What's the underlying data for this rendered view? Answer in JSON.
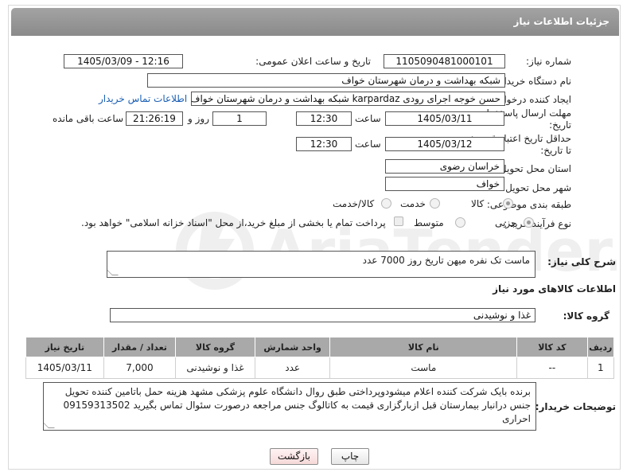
{
  "header": {
    "title": "جزئیات اطلاعات نیاز"
  },
  "form": {
    "need_number": {
      "label": "شماره نیاز:",
      "value": "1105090481000101"
    },
    "announce": {
      "label": "تاریخ و ساعت اعلان عمومی:",
      "value": "1405/03/09 - 12:16"
    },
    "buyer": {
      "label": "نام دستگاه خریدار:",
      "value": "شبکه بهداشت و درمان شهرستان خواف"
    },
    "requester": {
      "label": "ایجاد کننده درخواست:",
      "value": "حسن خوجه اجرای رودی karpardaz شبکه بهداشت و درمان شهرستان خواف",
      "contact_link": "اطلاعات تماس خریدار"
    },
    "deadline": {
      "label_line1": "مهلت ارسال پاسخ: تا",
      "label_line2": "تاریخ:",
      "date": "1405/03/11",
      "time_label": "ساعت",
      "time": "12:30",
      "days": "1",
      "days_label": "روز و",
      "remaining": "21:26:19",
      "remaining_label": "ساعت باقی مانده"
    },
    "validity": {
      "label_line1": "حداقل تاریخ اعتبار قیمت:",
      "label_line2": "تا تاریخ:",
      "date": "1405/03/12",
      "time_label": "ساعت",
      "time": "12:30"
    },
    "province": {
      "label": "استان محل تحویل:",
      "value": "خراسان رضوی"
    },
    "city": {
      "label": "شهر محل تحویل:",
      "value": "خواف"
    },
    "category": {
      "label": "طبقه بندی موضوعی:",
      "options": [
        "کالا",
        "خدمت",
        "کالا/خدمت"
      ],
      "selected_index": 0
    },
    "process": {
      "label": "نوع فرآیند خرید :",
      "options": [
        "جزیی",
        "متوسط"
      ],
      "selected_index": 0,
      "payment_note": "پرداخت تمام یا بخشی از مبلغ خرید،از محل \"اسناد خزانه اسلامی\" خواهد بود."
    }
  },
  "description": {
    "label": "شرح کلی نیاز:",
    "value": "ماست تک نفره میهن تاریخ روز 7000 عدد"
  },
  "goods_section": {
    "title": "اطلاعات کالاهای مورد نیاز",
    "group_label": "گروه کالا:",
    "group_value": "غذا و نوشیدنی"
  },
  "table": {
    "headers": [
      "ردیف",
      "کد کالا",
      "نام کالا",
      "واحد شمارش",
      "گروه کالا",
      "تعداد / مقدار",
      "تاریخ نیاز"
    ],
    "rows": [
      [
        "1",
        "--",
        "ماست",
        "عدد",
        "غذا و نوشیدنی",
        "7,000",
        "1405/03/11"
      ]
    ]
  },
  "buyer_notes": {
    "label": "توضیحات خریدار:",
    "value": "برنده بایک شرکت کننده اعلام میشودوپرداختی طبق روال دانشگاه علوم پزشکی مشهد هزینه حمل باتامین کننده تحویل جنس درانبار بیمارستان قبل ازبارگزاری قیمت به کاتالوگ جنس مراجعه درصورت سئوال تماس بگیرید 09159313502 احراری"
  },
  "buttons": {
    "print": "چاپ",
    "back": "بازگشت"
  },
  "colors": {
    "header_bg": "#9a9a9a",
    "link": "#1a5fb4",
    "back_button_bg": "#fbe3e3"
  }
}
